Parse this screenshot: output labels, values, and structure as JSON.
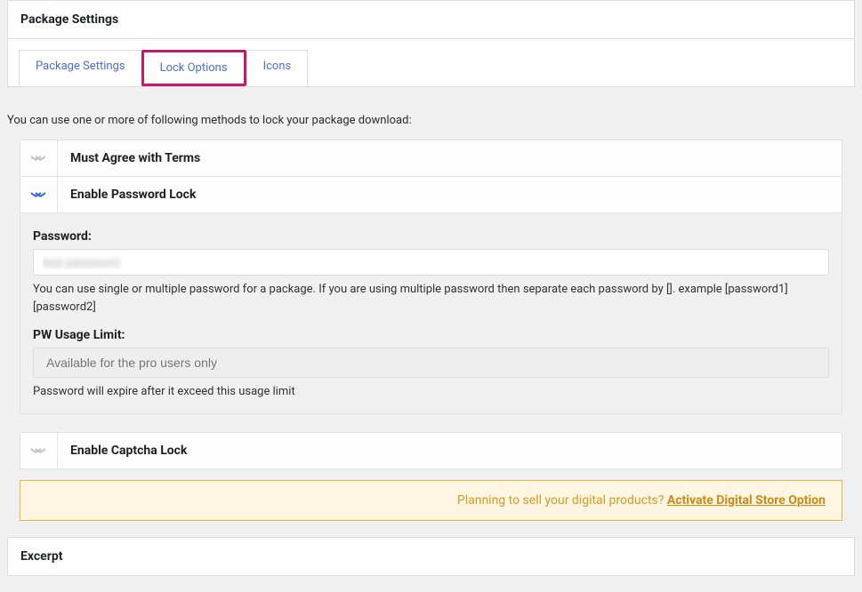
{
  "panel": {
    "title": "Package Settings"
  },
  "tabs": {
    "package_settings": "Package Settings",
    "lock_options": "Lock Options",
    "icons": "Icons"
  },
  "intro": "You can use one or more of following methods to lock your package download:",
  "accordion": {
    "must_agree": {
      "title": "Must Agree with Terms"
    },
    "password_lock": {
      "title": "Enable Password Lock",
      "password_label": "Password:",
      "password_value": "test password",
      "password_help": "You can use single or multiple password for a package. If you are using multiple password then separate each password by []. example [password1][password2]",
      "pw_limit_label": "PW Usage Limit:",
      "pw_limit_placeholder": "Available for the pro users only",
      "pw_limit_help": "Password will expire after it exceed this usage limit"
    },
    "captcha_lock": {
      "title": "Enable Captcha Lock"
    }
  },
  "promo": {
    "text": "Planning to sell your digital products? ",
    "link": "Activate Digital Store Option"
  },
  "excerpt": {
    "title": "Excerpt"
  }
}
